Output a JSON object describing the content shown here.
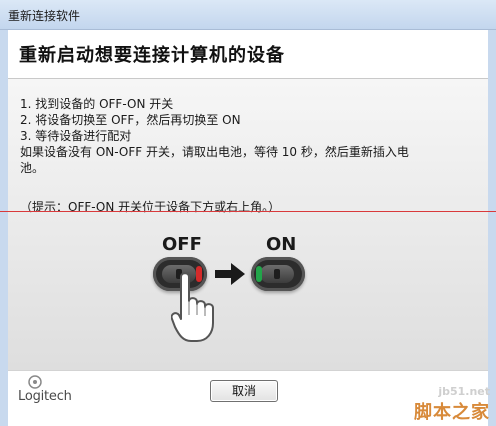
{
  "window": {
    "title": "重新连接软件"
  },
  "header": {
    "title": "重新启动想要连接计算机的设备"
  },
  "instructions": {
    "steps": [
      "1. 找到设备的 OFF-ON 开关",
      "2. 将设备切换至 OFF，然后再切换至 ON",
      "3. 等待设备进行配对"
    ],
    "battery_line1": "如果设备没有 ON-OFF 开关，请取出电池，等待 10 秒，然后重新插入电",
    "battery_line2": "池。",
    "tip": "（提示：OFF-ON 开关位于设备下方或右上角。）"
  },
  "illustration": {
    "off_label": "OFF",
    "on_label": "ON",
    "off_indicator_color": "#d42a2a",
    "on_indicator_color": "#22a54a"
  },
  "footer": {
    "logo_text": "Logitech",
    "cancel_label": "取消"
  },
  "watermark": {
    "url": "jb51.net",
    "name": "脚本之家"
  }
}
